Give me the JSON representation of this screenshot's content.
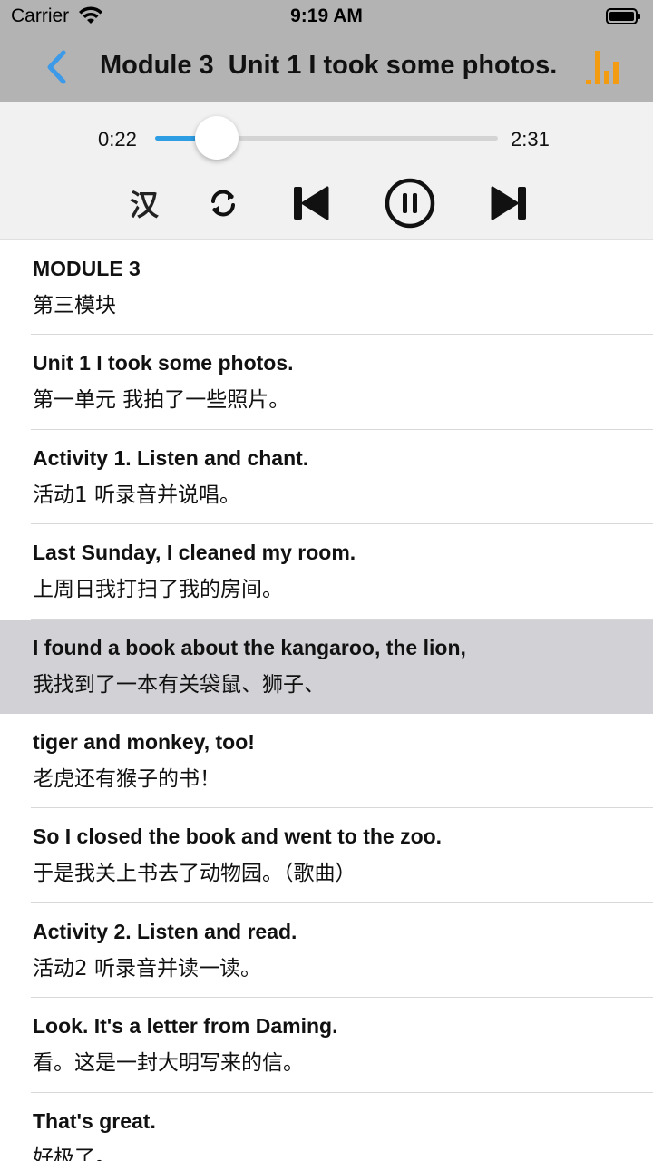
{
  "status_bar": {
    "carrier": "Carrier",
    "time": "9:19 AM"
  },
  "nav": {
    "title": "Module 3  Unit 1 I took some photos.",
    "back_icon": "chevron-left-icon",
    "right_icon": "equalizer-icon",
    "accent_color": "#3d9ae8",
    "eq_color": "#f39c12"
  },
  "player": {
    "current_time": "0:22",
    "total_time": "2:31",
    "progress": 0.18,
    "translate_label": "汉",
    "controls": [
      "translate-toggle",
      "repeat-icon",
      "previous-icon",
      "pause-icon",
      "next-icon"
    ]
  },
  "lines": [
    {
      "en": "MODULE 3",
      "zh": "第三模块"
    },
    {
      "en": "Unit 1 I took some photos.",
      "zh": "第一单元 我拍了一些照片。"
    },
    {
      "en": "Activity 1. Listen and chant.",
      "zh": "活动1 听录音并说唱。"
    },
    {
      "en": "Last Sunday, I cleaned my room.",
      "zh": "上周日我打扫了我的房间。"
    },
    {
      "en": "I found a book about the kangaroo, the lion,",
      "zh": "我找到了一本有关袋鼠、狮子、",
      "selected": true
    },
    {
      "en": "tiger and monkey, too!",
      "zh": "老虎还有猴子的书！"
    },
    {
      "en": "So I closed the book and went to the zoo.",
      "zh": "于是我关上书去了动物园。（歌曲）"
    },
    {
      "en": "Activity 2. Listen and read.",
      "zh": "活动2 听录音并读一读。"
    },
    {
      "en": "Look. It's a letter from Daming.",
      "zh": "看。这是一封大明写来的信。"
    },
    {
      "en": "That's great.",
      "zh": "好极了。"
    }
  ]
}
